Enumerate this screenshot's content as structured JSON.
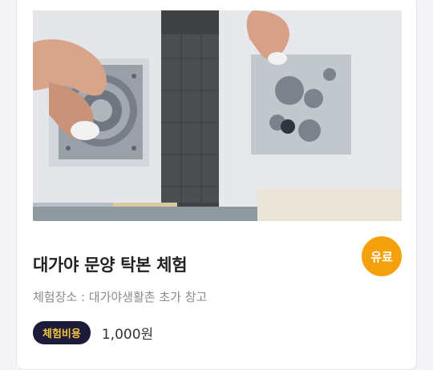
{
  "card": {
    "title": "대가야 문양 탁본 체험",
    "place": "체험장소 : 대가야생활촌 초가 창고",
    "fee_label": "체험비용",
    "fee_value": "1,000원",
    "paid_badge": "유료"
  },
  "colors": {
    "paid_badge": "#f5a10d",
    "fee_badge_bg": "#1c1c3a",
    "fee_badge_text": "#f5c543",
    "title": "#222222",
    "place": "#8a8a8a"
  }
}
